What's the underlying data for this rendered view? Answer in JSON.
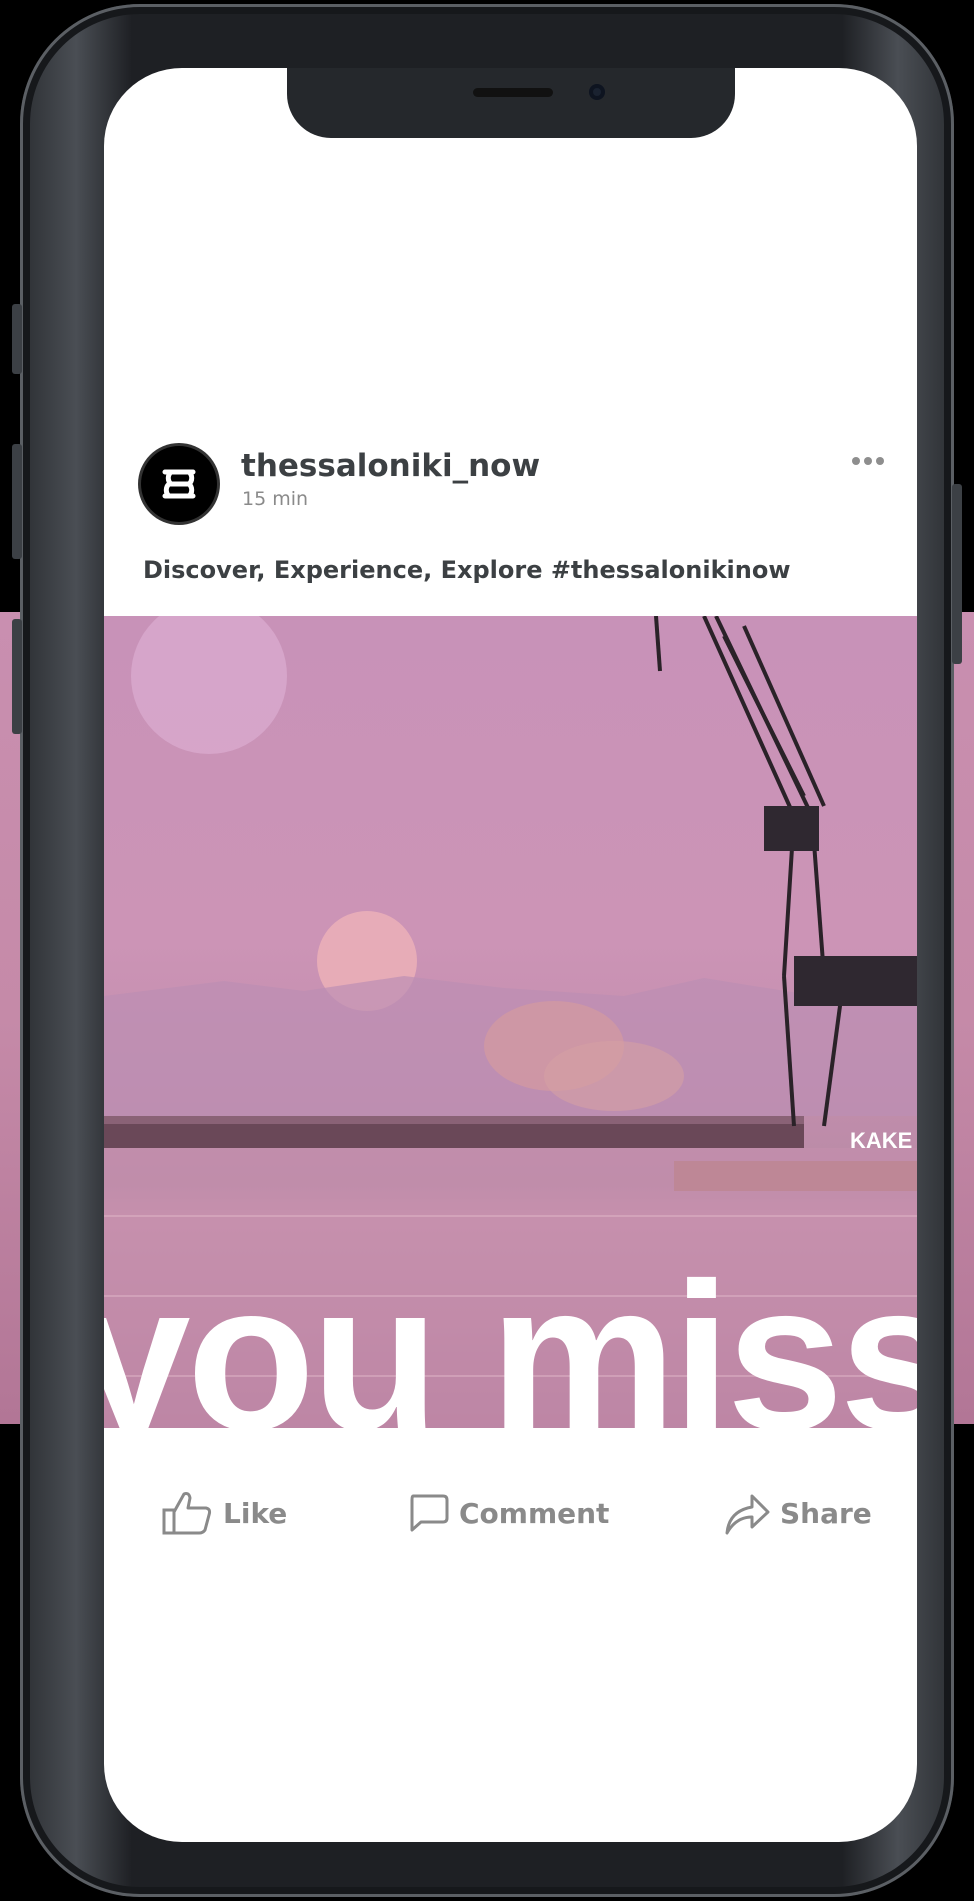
{
  "post": {
    "username": "thessaloniki_now",
    "time": "15 min",
    "caption": "Discover, Experience, Explore #thessalonikinow",
    "overlay_text": "you miss",
    "sign_text": "KAKE"
  },
  "actions": {
    "like": "Like",
    "comment": "Comment",
    "share": "Share"
  },
  "colors": {
    "text_dark": "#3c4043",
    "text_muted": "#8a8a8a",
    "photo_pink": "#c892b8"
  },
  "icons": [
    "more-icon",
    "like-icon",
    "comment-icon",
    "share-icon",
    "avatar-logo-icon"
  ]
}
